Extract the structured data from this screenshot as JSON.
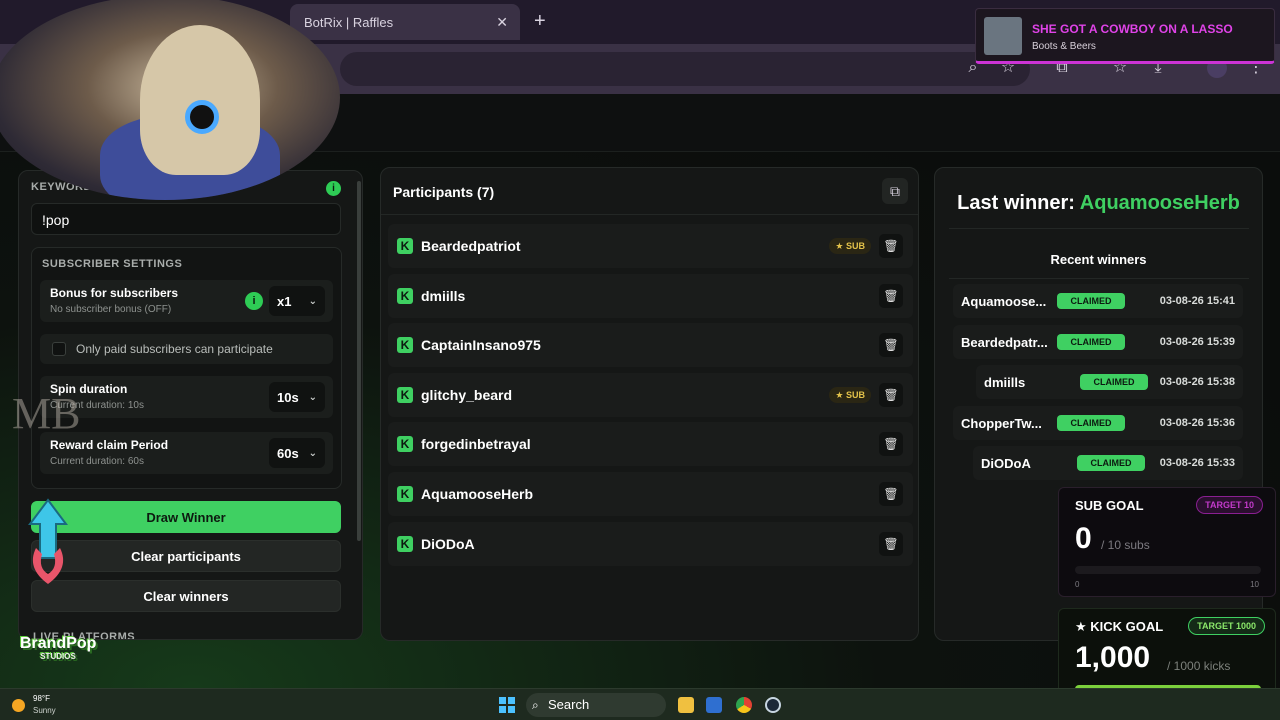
{
  "browser": {
    "tab_title": "BotRix | Raffles",
    "tab_close": "✕",
    "new_tab": "+"
  },
  "music": {
    "title": "SHE GOT A COWBOY ON A LASSO",
    "artist": "Boots & Beers"
  },
  "left_panel": {
    "keyword_label": "KEYWORD",
    "keyword_info": "i",
    "keyword_value": "!pop",
    "subscriber_settings_title": "SUBSCRIBER SETTINGS",
    "bonus": {
      "title": "Bonus for subscribers",
      "subtitle": "No subscriber bonus (OFF)",
      "value": "x1"
    },
    "paid_only_label": "Only paid subscribers can participate",
    "spin": {
      "title": "Spin duration",
      "subtitle": "Current duration: 10s",
      "value": "10s"
    },
    "claim": {
      "title": "Reward claim Period",
      "subtitle": "Current duration: 60s",
      "value": "60s"
    },
    "draw_winner": "Draw Winner",
    "clear_participants": "Clear participants",
    "clear_winners": "Clear winners",
    "platforms_label": "LIVE PLATFORMS"
  },
  "participants": {
    "title": "Participants (7)",
    "sub_badge": "★ SUB",
    "items": [
      {
        "name": "Beardedpatriot",
        "sub": true
      },
      {
        "name": "dmiills",
        "sub": false
      },
      {
        "name": "CaptainInsano975",
        "sub": false
      },
      {
        "name": "glitchy_beard",
        "sub": true
      },
      {
        "name": "forgedinbetrayal",
        "sub": false
      },
      {
        "name": "AquamooseHerb",
        "sub": false
      },
      {
        "name": "DiODoA",
        "sub": false
      }
    ]
  },
  "winners": {
    "last_winner_label": "Last winner:",
    "last_winner_name": "AquamooseHerb",
    "recent_title": "Recent winners",
    "items": [
      {
        "name": "Aquamoose...",
        "status": "CLAIMED",
        "time": "03-08-26 15:41"
      },
      {
        "name": "Beardedpatr...",
        "status": "CLAIMED",
        "time": "03-08-26 15:39"
      },
      {
        "name": "dmiills",
        "status": "CLAIMED",
        "time": "03-08-26 15:38"
      },
      {
        "name": "ChopperTw...",
        "status": "CLAIMED",
        "time": "03-08-26 15:36"
      },
      {
        "name": "DiODoA",
        "status": "CLAIMED",
        "time": "03-08-26 15:33"
      }
    ]
  },
  "sub_goal": {
    "title": "SUB GOAL",
    "target": "TARGET 10",
    "value": "0",
    "of": "/ 10 subs",
    "min": "0",
    "max": "10",
    "progress": 0
  },
  "kick_goal": {
    "title": "★ KICK GOAL",
    "target": "TARGET 1000",
    "value": "1,000",
    "of": "/ 1000 kicks",
    "min": "0",
    "max": "1000",
    "progress": 1.0
  },
  "overlay": {
    "brand_name": "BrandPop",
    "brand_sub": "STUDIOS",
    "watermark": "MB"
  },
  "taskbar": {
    "weather_temp": "98°F",
    "weather_cond": "Sunny",
    "search": "Search"
  },
  "colors": {
    "accent_green": "#3fd062",
    "sub_goal_magenta": "#c13ac9"
  }
}
